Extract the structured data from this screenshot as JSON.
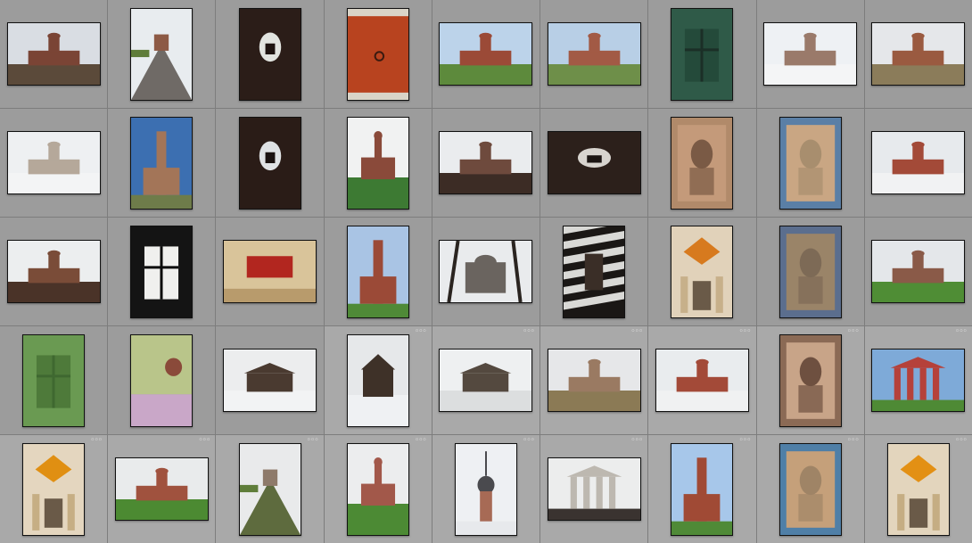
{
  "app": {
    "view": "grid",
    "rows": 5,
    "columns": 9
  },
  "colors": {
    "panel": "#9c9c9c",
    "selected_cell": "#a9a9a9",
    "thumbnail_border": "#111111"
  },
  "badge_glyph": "◦◦◦",
  "thumbnails": [
    {
      "orientation": "land",
      "kind": "church-ruin",
      "sky": "#d9dde3",
      "ground": "#5b4a3a",
      "wall": "#7a4435",
      "badge": false
    },
    {
      "orientation": "port",
      "kind": "road",
      "sky": "#e8ecef",
      "ground": "#6f6a66",
      "wall": "#8d5a45",
      "badge": false
    },
    {
      "orientation": "port",
      "kind": "arch-dark",
      "sky": "#e2e4e0",
      "ground": "#1e1411",
      "wall": "#2b1d18",
      "badge": false
    },
    {
      "orientation": "port",
      "kind": "door-red",
      "sky": "#c84e2a",
      "ground": "#d9d4c8",
      "wall": "#b8431f",
      "badge": false
    },
    {
      "orientation": "land",
      "kind": "church-field",
      "sky": "#bcd3ea",
      "ground": "#5d8a3c",
      "wall": "#9b4a37",
      "badge": false
    },
    {
      "orientation": "land",
      "kind": "church-red",
      "sky": "#b8cfe6",
      "ground": "#6e8f49",
      "wall": "#a25a45",
      "badge": false
    },
    {
      "orientation": "port",
      "kind": "window-green",
      "sky": "#244a3a",
      "ground": "#1b2f27",
      "wall": "#2f5a48",
      "badge": false
    },
    {
      "orientation": "land",
      "kind": "church-winter",
      "sky": "#eef1f4",
      "ground": "#f4f5f6",
      "wall": "#9a7a6a",
      "badge": false
    },
    {
      "orientation": "land",
      "kind": "church-dome",
      "sky": "#e5e7ea",
      "ground": "#8b7c5a",
      "wall": "#9a5a40",
      "badge": false
    },
    {
      "orientation": "land",
      "kind": "church-winter",
      "sky": "#eef0f2",
      "ground": "#f3f4f5",
      "wall": "#b5a89a",
      "badge": false
    },
    {
      "orientation": "port",
      "kind": "tower-blue",
      "sky": "#3c6fb1",
      "ground": "#6e7c4a",
      "wall": "#a37558",
      "badge": false
    },
    {
      "orientation": "port",
      "kind": "arch-dark",
      "sky": "#dfe2e4",
      "ground": "#1a1210",
      "wall": "#2a1c17",
      "badge": false
    },
    {
      "orientation": "port",
      "kind": "church-field",
      "sky": "#f1f2f2",
      "ground": "#3d7a33",
      "wall": "#8a4a3a",
      "badge": false
    },
    {
      "orientation": "land",
      "kind": "church-dome",
      "sky": "#eaecee",
      "ground": "#3c2c25",
      "wall": "#6e4a3d",
      "badge": false
    },
    {
      "orientation": "land",
      "kind": "arch-dark",
      "sky": "#d8d4cf",
      "ground": "#1c1513",
      "wall": "#2c201b",
      "badge": false
    },
    {
      "orientation": "port",
      "kind": "fresco",
      "sky": "#b18a6a",
      "ground": "#7a5a45",
      "wall": "#c49a7a",
      "badge": false
    },
    {
      "orientation": "port",
      "kind": "fresco-blue",
      "sky": "#5a7fa6",
      "ground": "#a88e6e",
      "wall": "#c9a683",
      "badge": false
    },
    {
      "orientation": "land",
      "kind": "church-winter",
      "sky": "#e7eaed",
      "ground": "#f1f2f3",
      "wall": "#a34a38",
      "badge": false
    },
    {
      "orientation": "land",
      "kind": "church-dome",
      "sky": "#eceeef",
      "ground": "#4a3328",
      "wall": "#7a4c38",
      "badge": false
    },
    {
      "orientation": "port",
      "kind": "window-dark",
      "sky": "#f0f0ee",
      "ground": "#0b0b0b",
      "wall": "#141414",
      "badge": false
    },
    {
      "orientation": "land",
      "kind": "interior-red",
      "sky": "#d9c49a",
      "ground": "#b89b6c",
      "wall": "#b2261f",
      "badge": false
    },
    {
      "orientation": "port",
      "kind": "tower-blue",
      "sky": "#a9c4e4",
      "ground": "#4f8a37",
      "wall": "#9b4a37",
      "badge": false
    },
    {
      "orientation": "land",
      "kind": "trees-church",
      "sky": "#e9ebed",
      "ground": "#2a2420",
      "wall": "#6a645f",
      "badge": false
    },
    {
      "orientation": "port",
      "kind": "stripes",
      "sky": "#d9d9d6",
      "ground": "#1a1715",
      "wall": "#3a2e27",
      "badge": false
    },
    {
      "orientation": "port",
      "kind": "interior-dome",
      "sky": "#e1d2ba",
      "ground": "#c7b08a",
      "wall": "#d77a1e",
      "badge": false
    },
    {
      "orientation": "port",
      "kind": "fresco-blue",
      "sky": "#5b6e8e",
      "ground": "#7d6a56",
      "wall": "#9a8468",
      "badge": false
    },
    {
      "orientation": "land",
      "kind": "church-field",
      "sky": "#e4e7ea",
      "ground": "#4f8d35",
      "wall": "#8a5a48",
      "badge": false
    },
    {
      "orientation": "port",
      "kind": "window-green",
      "sky": "#4e7a3a",
      "ground": "#3f6830",
      "wall": "#6a9a52",
      "badge": false
    },
    {
      "orientation": "port",
      "kind": "wallpaper",
      "sky": "#b9c58a",
      "ground": "#c9a7c8",
      "wall": "#8a4a3a",
      "badge": false
    },
    {
      "orientation": "land",
      "kind": "house-wood",
      "sky": "#ecedee",
      "ground": "#f2f3f4",
      "wall": "#4a3a30",
      "badge": false
    },
    {
      "orientation": "port",
      "kind": "house-wood",
      "sky": "#e6e8ea",
      "ground": "#eff1f3",
      "wall": "#3e3128",
      "badge": true
    },
    {
      "orientation": "land",
      "kind": "house-wood",
      "sky": "#eef0f1",
      "ground": "#dcdedf",
      "wall": "#54493f",
      "badge": true
    },
    {
      "orientation": "land",
      "kind": "church-field",
      "sky": "#e6e7e9",
      "ground": "#8b7a55",
      "wall": "#9a7a62",
      "badge": true
    },
    {
      "orientation": "land",
      "kind": "church-winter",
      "sky": "#e9ecee",
      "ground": "#f0f1f2",
      "wall": "#a34a38",
      "badge": true
    },
    {
      "orientation": "port",
      "kind": "fresco",
      "sky": "#8b6a55",
      "ground": "#6e5040",
      "wall": "#c8a488",
      "badge": true
    },
    {
      "orientation": "land",
      "kind": "portico",
      "sky": "#7eaad8",
      "ground": "#4e8a35",
      "wall": "#b5413a",
      "badge": true
    },
    {
      "orientation": "port",
      "kind": "interior-dome",
      "sky": "#e4d6bf",
      "ground": "#c6ae84",
      "wall": "#e08f12",
      "badge": true
    },
    {
      "orientation": "land",
      "kind": "church-field",
      "sky": "#e9ebec",
      "ground": "#4c8a32",
      "wall": "#a0523e",
      "badge": true
    },
    {
      "orientation": "port",
      "kind": "road",
      "sky": "#e9eaeb",
      "ground": "#5e6b3e",
      "wall": "#8e7a6a",
      "badge": true
    },
    {
      "orientation": "port",
      "kind": "church-field",
      "sky": "#ecedee",
      "ground": "#4c8a34",
      "wall": "#a2584a",
      "badge": true
    },
    {
      "orientation": "port",
      "kind": "spire-snow",
      "sky": "#eef0f3",
      "ground": "#e7e9ec",
      "wall": "#4a4a4e",
      "badge": true
    },
    {
      "orientation": "land",
      "kind": "portico",
      "sky": "#eceded",
      "ground": "#3a3330",
      "wall": "#bdb8b0",
      "badge": true
    },
    {
      "orientation": "port",
      "kind": "tower-blue",
      "sky": "#a7c7ea",
      "ground": "#4f8a37",
      "wall": "#a04a35",
      "badge": true
    },
    {
      "orientation": "port",
      "kind": "fresco-blue",
      "sky": "#4f7fa7",
      "ground": "#9f8466",
      "wall": "#c5a07a",
      "badge": true
    },
    {
      "orientation": "port",
      "kind": "interior-dome",
      "sky": "#e3d5bd",
      "ground": "#c5ad83",
      "wall": "#e39014",
      "badge": true
    }
  ]
}
